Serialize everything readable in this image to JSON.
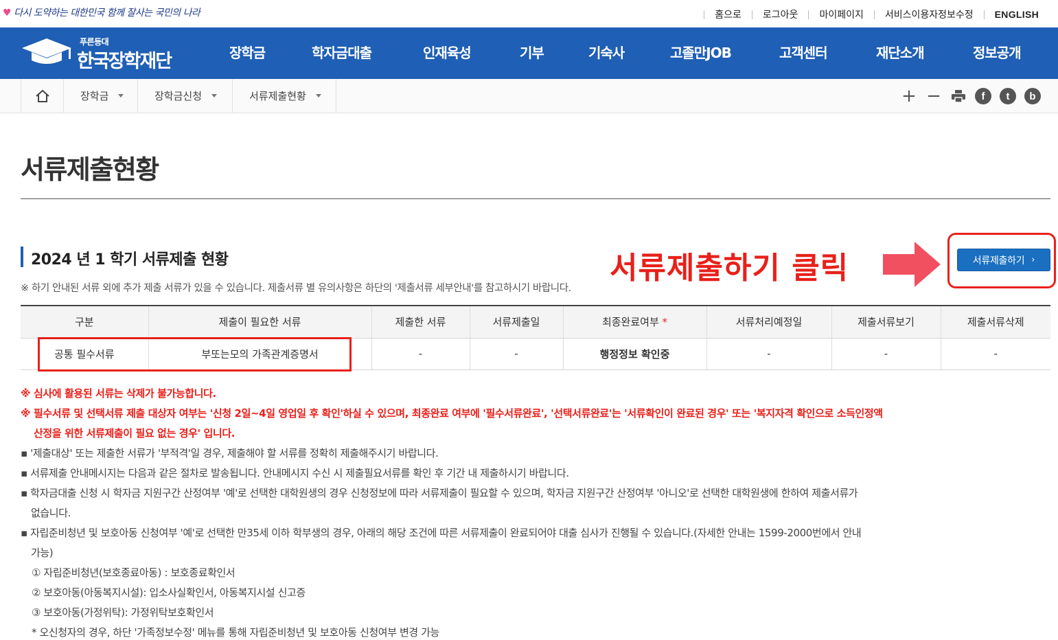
{
  "topbar": {
    "slogan": "다시 도약하는 대한민국 함께 잘사는 국민의 나라",
    "links": [
      "홈으로",
      "로그아웃",
      "마이페이지",
      "서비스이용자정보수정",
      "ENGLISH"
    ]
  },
  "header": {
    "logo_small": "푸른등대",
    "logo_name": "한국장학재단",
    "menu": [
      "장학금",
      "학자금대출",
      "인재육성",
      "기부",
      "기숙사",
      "고졸만JOB",
      "고객센터",
      "재단소개",
      "정보공개"
    ]
  },
  "breadcrumb": {
    "items": [
      "장학금",
      "장학금신청",
      "서류제출현황"
    ],
    "tools": {
      "zoom_in": "+",
      "zoom_out": "−",
      "facebook": "f",
      "twitter": "t",
      "blog": "b"
    }
  },
  "page": {
    "title": "서류제출현황"
  },
  "section": {
    "title": "2024 년 1 학기 서류제출 현황",
    "note": "※ 하기 안내된 서류 외에 추가 제출 서류가 있을 수 있습니다. 제출서류 별 유의사항은 하단의 '제출서류 세부안내'를 참고하시기 바랍니다.",
    "submit_button": "서류제출하기",
    "annotation": "서류제출하기 클릭"
  },
  "table": {
    "headers": [
      "구분",
      "제출이 필요한 서류",
      "제출한 서류",
      "서류제출일",
      "최종완료여부",
      "서류처리예정일",
      "제출서류보기",
      "제출서류삭제"
    ],
    "required_mark": "*",
    "rows": [
      [
        "공통 필수서류",
        "부또는모의 가족관계증명서",
        "-",
        "-",
        "행정정보 확인중",
        "-",
        "-",
        "-"
      ]
    ]
  },
  "notes": {
    "red1": "※ 심사에 활용된 서류는 삭제가 불가능합니다.",
    "red2a": "※ 필수서류 및 선택서류 제출 대상자 여부는 '신청 2일~4일 영업일 후 확인'하실 수 있으며, 최종완료 여부에 '필수서류완료', '선택서류완료'는 '서류확인이 완료된 경우' 또는 '복지자격 확인으로 소득인정액",
    "red2b": "산정을 위한 서류제출이 필요 없는 경우' 입니다.",
    "b1": "▪ '제출대상' 또는 제출한 서류가 '부적격'일 경우, 제출해야 할 서류를 정확히 제출해주시기 바랍니다.",
    "b2": "▪ 서류제출 안내메시지는 다음과 같은 절차로 발송됩니다. 안내메시지 수신 시 제출필요서류를 확인 후 기간 내 제출하시기 바랍니다.",
    "b3a": "▪ 학자금대출 신청 시 학자금 지원구간 산정여부 '예'로 선택한 대학원생의 경우 신청정보에 따라 서류제출이 필요할 수 있으며, 학자금 지원구간 산정여부 '아니오'로 선택한 대학원생에 한하여 제출서류가",
    "b3b": "없습니다.",
    "b4a": "▪ 자립준비청년 및 보호아동 신청여부 '예'로 선택한 만35세 이하 학부생의 경우, 아래의 해당 조건에 따른 서류제출이 완료되어야 대출 심사가 진행될 수 있습니다.(자세한 안내는 1599-2000번에서 안내",
    "b4b": "가능)",
    "s1": "① 자립준비청년(보호종료아동) : 보호종료확인서",
    "s2": "② 보호아동(아동복지시설): 입소사실확인서, 아동복지시설 신고증",
    "s3": "③ 보호아동(가정위탁): 가정위탁보호확인서",
    "s4": "* 오신청자의 경우, 하단 '가족정보수정' 메뉴를 통해 자립준비청년 및 보호아동 신청여부 변경 가능"
  },
  "colors": {
    "brand_blue": "#1f5fb5",
    "button_blue": "#1a6fc0",
    "annotation_red": "#e8201a"
  }
}
